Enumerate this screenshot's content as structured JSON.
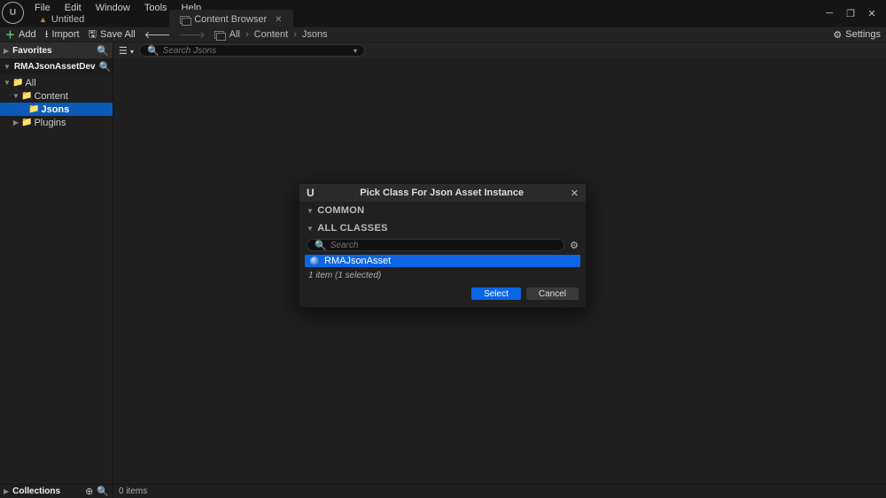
{
  "menu": [
    "File",
    "Edit",
    "Window",
    "Tools",
    "Help"
  ],
  "tabs": {
    "untitled_label": "Untitled",
    "content_browser_label": "Content Browser"
  },
  "toolbar": {
    "add_label": "Add",
    "import_label": "Import",
    "save_all_label": "Save All",
    "settings_label": "Settings"
  },
  "breadcrumbs": [
    "All",
    "Content",
    "Jsons"
  ],
  "sidebar": {
    "favorites_label": "Favorites",
    "project_label": "RMAJsonAssetDev",
    "collections_label": "Collections",
    "tree": {
      "all": "All",
      "content": "Content",
      "jsons": "Jsons",
      "plugins": "Plugins"
    }
  },
  "filter": {
    "search_placeholder": "Search Jsons"
  },
  "status": {
    "items_label": "0 items"
  },
  "modal": {
    "title": "Pick Class For Json Asset Instance",
    "common_label": "COMMON",
    "all_classes_label": "ALL CLASSES",
    "search_placeholder": "Search",
    "class_result": "RMAJsonAsset",
    "status_line": "1 item (1 selected)",
    "select_label": "Select",
    "cancel_label": "Cancel"
  }
}
